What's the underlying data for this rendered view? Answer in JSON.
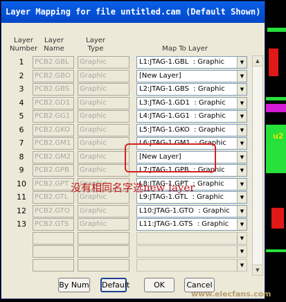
{
  "title": "Layer Mapping for file untitled.cam (Default Shown)",
  "headers": {
    "layer_number": "Layer\nNumber",
    "layer_name": "Layer\nName",
    "layer_type": "Layer\nType",
    "map_to_layer": "Map To Layer"
  },
  "rows": [
    {
      "num": "1",
      "name": "PCB2.GBL",
      "type": "Graphic",
      "map": "L1:JTAG-1.GBL  : Graphic"
    },
    {
      "num": "2",
      "name": "PCB2.GBO",
      "type": "Graphic",
      "map": "[New Layer]"
    },
    {
      "num": "3",
      "name": "PCB2.GBS",
      "type": "Graphic",
      "map": "L2:JTAG-1.GBS  : Graphic"
    },
    {
      "num": "4",
      "name": "PCB2.GD1",
      "type": "Graphic",
      "map": "L3:JTAG-1.GD1  : Graphic"
    },
    {
      "num": "5",
      "name": "PCB2.GG1",
      "type": "Graphic",
      "map": "L4:JTAG-1.GG1  : Graphic"
    },
    {
      "num": "6",
      "name": "PCB2.GKO",
      "type": "Graphic",
      "map": "L5:JTAG-1.GKO  : Graphic"
    },
    {
      "num": "7",
      "name": "PCB2.GM1",
      "type": "Graphic",
      "map": "L6:JTAG-1.GM1  : Graphic"
    },
    {
      "num": "8",
      "name": "PCB2.GM2",
      "type": "Graphic",
      "map": "[New Layer]"
    },
    {
      "num": "9",
      "name": "PCB2.GPB",
      "type": "Graphic",
      "map": "L7:JTAG-1.GPB  : Graphic"
    },
    {
      "num": "10",
      "name": "PCB2.GPT",
      "type": "Graphic",
      "map": "L8:JTAG-1.GPT  : Graphic"
    },
    {
      "num": "11",
      "name": "PCB2.GTL",
      "type": "Graphic",
      "map": "L9:JTAG-1.GTL  : Graphic"
    },
    {
      "num": "12",
      "name": "PCB2.GTO",
      "type": "Graphic",
      "map": "L10:JTAG-1.GTO  : Graphic"
    },
    {
      "num": "13",
      "name": "PCB2.GTS",
      "type": "Graphic",
      "map": "L11:JTAG-1.GTS  : Graphic"
    },
    {
      "num": "",
      "name": "",
      "type": "",
      "map": ""
    },
    {
      "num": "",
      "name": "",
      "type": "",
      "map": ""
    },
    {
      "num": "",
      "name": "",
      "type": "",
      "map": ""
    }
  ],
  "buttons": {
    "by_num": "By Num",
    "default": "Default",
    "ok": "OK",
    "cancel": "Cancel"
  },
  "annotation": "没有相同名字选new layer",
  "background_label": "u2",
  "watermark": "www.elecfans.com"
}
